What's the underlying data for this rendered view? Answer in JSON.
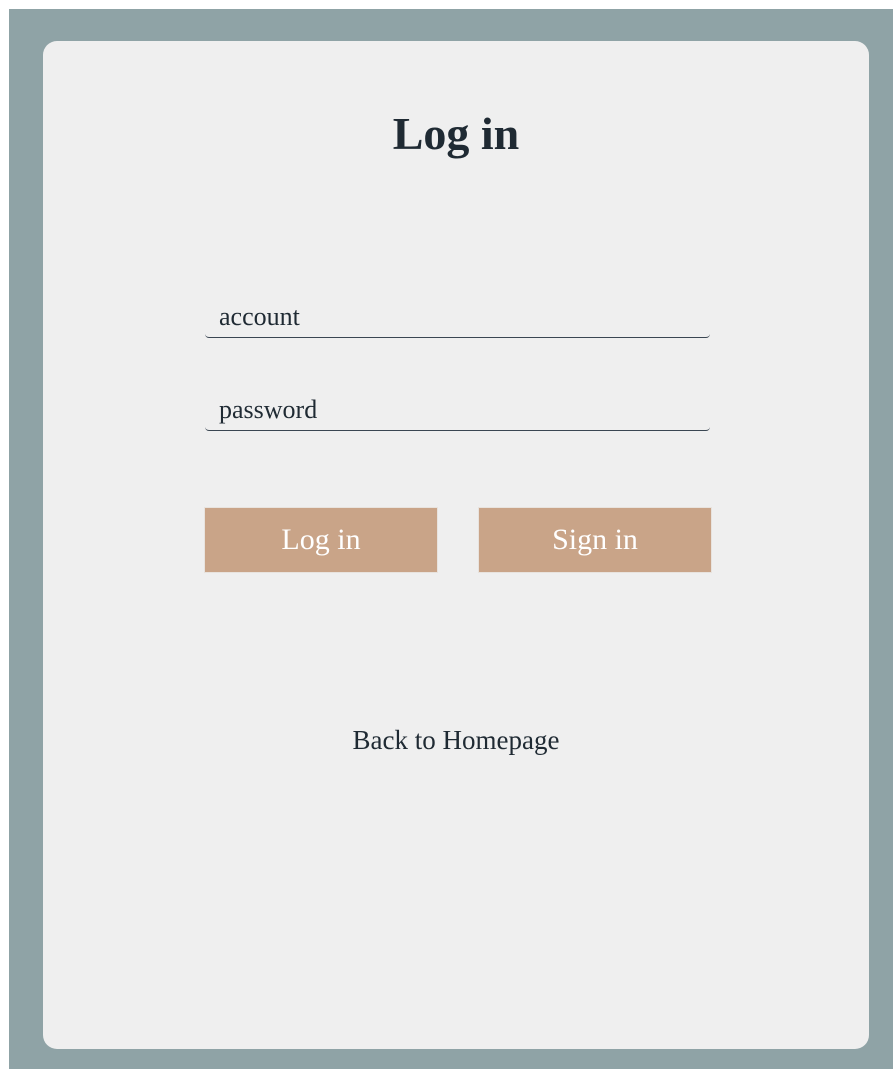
{
  "login_card": {
    "title": "Log in",
    "account_field": {
      "placeholder": "account",
      "value": ""
    },
    "password_field": {
      "placeholder": "password",
      "value": ""
    },
    "login_button_label": "Log in",
    "signin_button_label": "Sign in",
    "back_link_label": "Back to Homepage"
  },
  "colors": {
    "frame_background": "#8fa3a6",
    "card_background": "#efefef",
    "button_background": "#c9a488",
    "button_text": "#ffffff",
    "text": "#1f2a33"
  }
}
